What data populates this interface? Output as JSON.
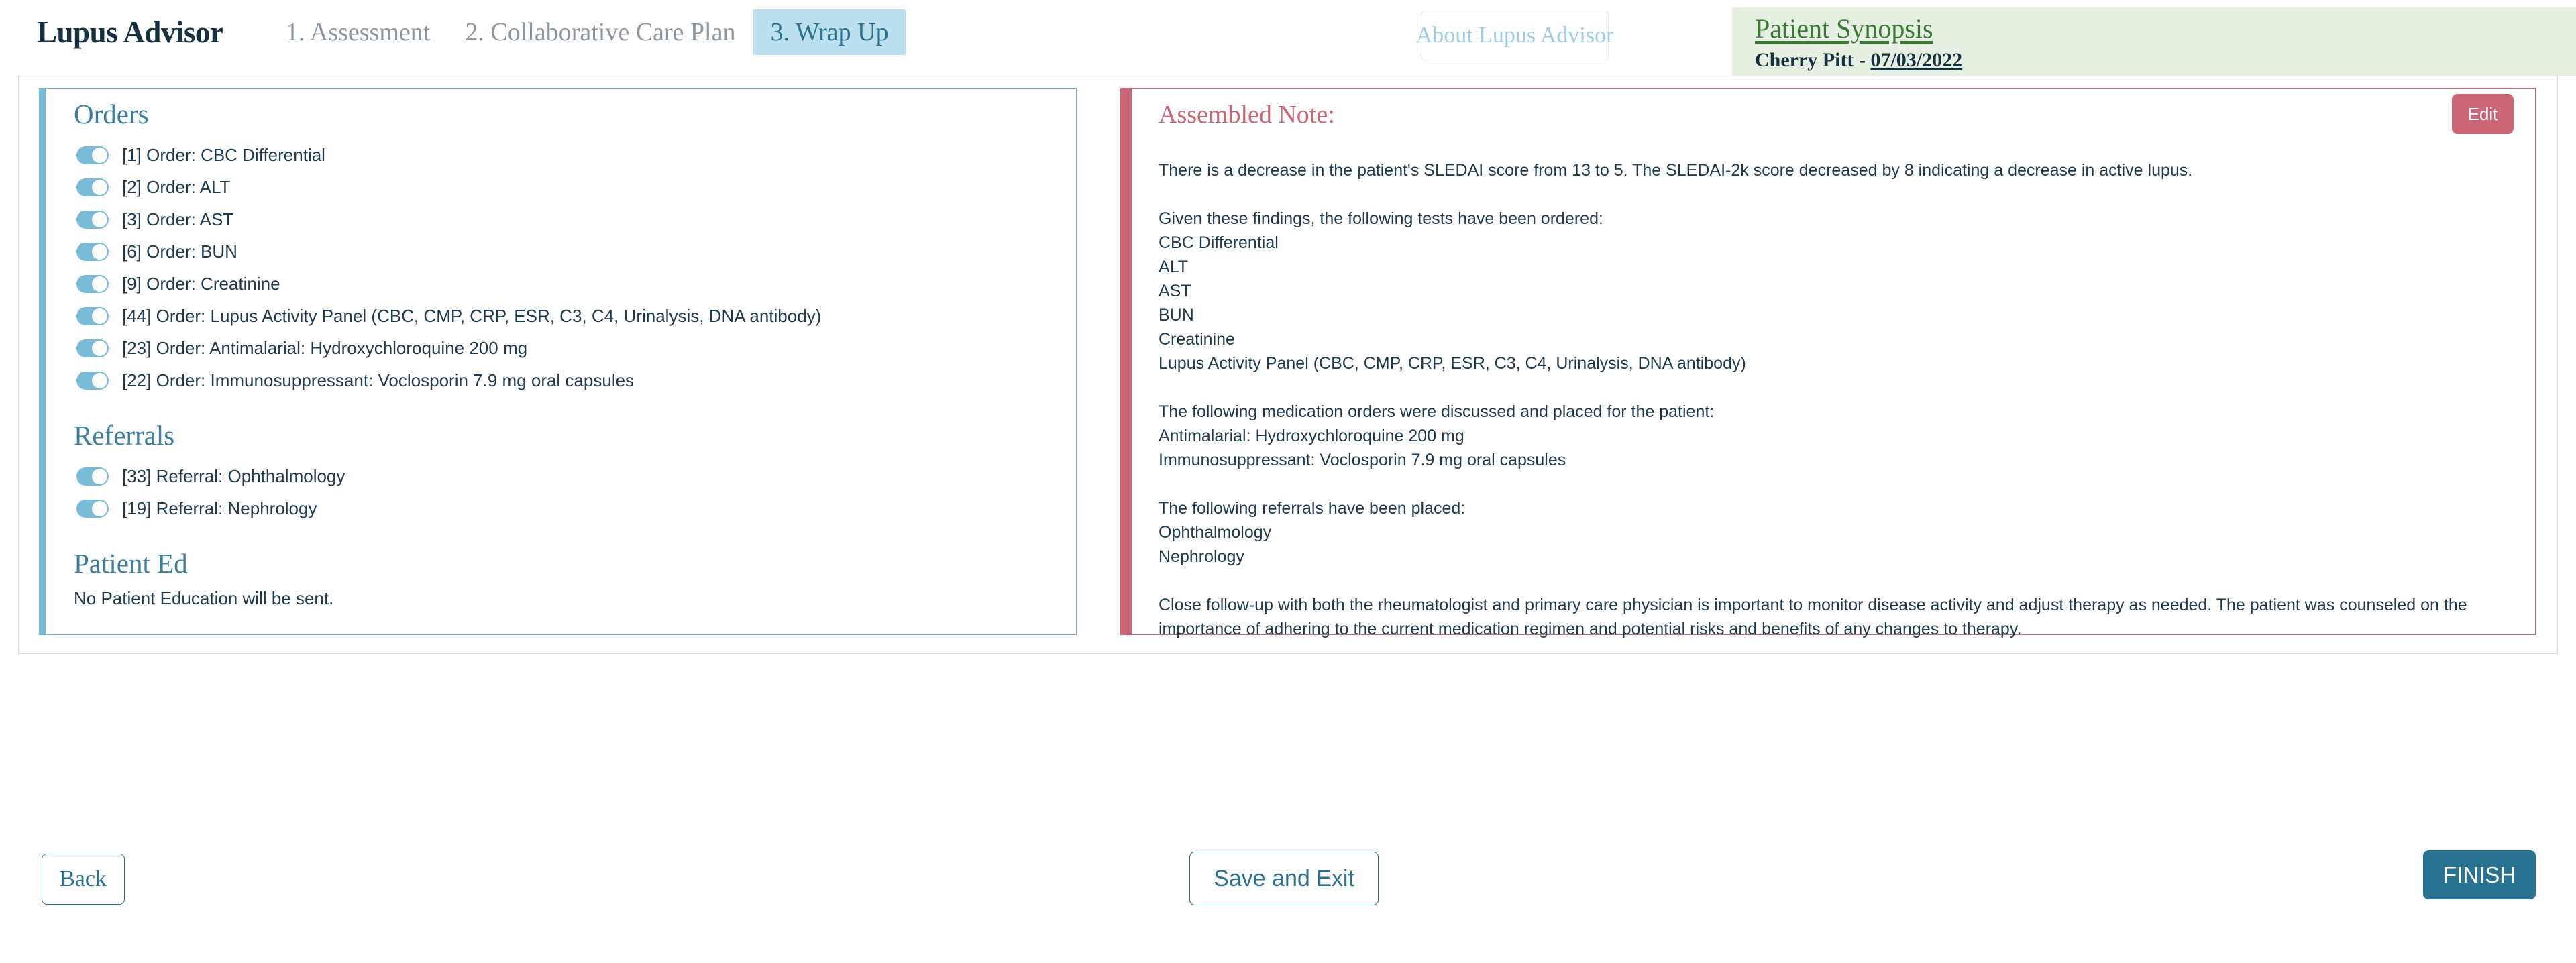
{
  "header": {
    "brand": "Lupus Advisor",
    "tabs": [
      {
        "label": "1. Assessment",
        "active": false
      },
      {
        "label": "2. Collaborative Care Plan",
        "active": false
      },
      {
        "label": "3. Wrap Up",
        "active": true
      }
    ],
    "about_button": "About Lupus Advisor",
    "synopsis": {
      "title": "Patient Synopsis",
      "patient_name": "Cherry Pitt",
      "separator": " - ",
      "date": "07/03/2022"
    }
  },
  "left_panel": {
    "orders": {
      "title": "Orders",
      "items": [
        {
          "label": "[1] Order: CBC Differential",
          "on": true
        },
        {
          "label": "[2] Order: ALT",
          "on": true
        },
        {
          "label": "[3] Order: AST",
          "on": true
        },
        {
          "label": "[6] Order: BUN",
          "on": true
        },
        {
          "label": "[9] Order: Creatinine",
          "on": true
        },
        {
          "label": "[44] Order: Lupus Activity Panel (CBC, CMP, CRP, ESR, C3, C4, Urinalysis, DNA antibody)",
          "on": true
        },
        {
          "label": "[23] Order: Antimalarial: Hydroxychloroquine 200 mg",
          "on": true
        },
        {
          "label": "[22] Order: Immunosuppressant: Voclosporin 7.9 mg oral capsules",
          "on": true
        }
      ]
    },
    "referrals": {
      "title": "Referrals",
      "items": [
        {
          "label": "[33] Referral: Ophthalmology",
          "on": true
        },
        {
          "label": "[19] Referral: Nephrology",
          "on": true
        }
      ]
    },
    "patient_ed": {
      "title": "Patient Ed",
      "text": "No Patient Education will be sent."
    }
  },
  "right_panel": {
    "title": "Assembled Note:",
    "edit_button": "Edit",
    "note": {
      "p1": "There is a decrease in the patient's SLEDAI score from 13 to 5. The SLEDAI-2k score decreased by 8 indicating a decrease in active lupus.",
      "tests_intro": "Given these findings, the following tests have been ordered:",
      "test_1": "CBC Differential",
      "test_2": "ALT",
      "test_3": "AST",
      "test_4": "BUN",
      "test_5": "Creatinine",
      "test_6": "Lupus Activity Panel (CBC, CMP, CRP, ESR, C3, C4, Urinalysis, DNA antibody)",
      "meds_intro": "The following medication orders were discussed and placed for the patient:",
      "med_1": "Antimalarial: Hydroxychloroquine 200 mg",
      "med_2": "Immunosuppressant: Voclosporin 7.9 mg oral capsules",
      "referrals_intro": "The following referrals have been placed:",
      "referral_1": "Ophthalmology",
      "referral_2": "Nephrology",
      "closing": "Close follow-up with both the rheumatologist and primary care physician is important to monitor disease activity and adjust therapy as needed. The patient was counseled on the importance of adhering to the current medication regimen and potential risks and benefits of any changes to therapy."
    }
  },
  "footer": {
    "back": "Back",
    "save_and_exit": "Save and Exit",
    "finish": "FINISH"
  },
  "colors": {
    "accent_blue": "#2a7292",
    "toggle_blue": "#79bcd8",
    "tab_active_bg": "#bde0ee",
    "note_rose": "#cc6677",
    "synopsis_green_bg": "#e5efe2",
    "synopsis_green_text": "#3b7a33"
  }
}
